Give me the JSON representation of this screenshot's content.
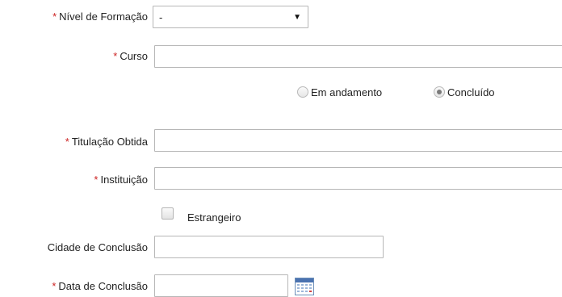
{
  "form": {
    "required_marker": "*",
    "nivel": {
      "label": "Nível de Formação",
      "selected": "-"
    },
    "curso": {
      "label": "Curso",
      "value": ""
    },
    "status": {
      "options": [
        {
          "label": "Em andamento",
          "checked": false
        },
        {
          "label": "Concluído",
          "checked": true
        }
      ]
    },
    "titulacao": {
      "label": "Titulação Obtida",
      "value": ""
    },
    "instituicao": {
      "label": "Instituição",
      "value": ""
    },
    "estrangeiro": {
      "label": "Estrangeiro",
      "checked": false
    },
    "cidade": {
      "label": "Cidade de Conclusão",
      "value": ""
    },
    "data": {
      "label": "Data de Conclusão",
      "value": "",
      "icon": "calendar-icon"
    }
  }
}
